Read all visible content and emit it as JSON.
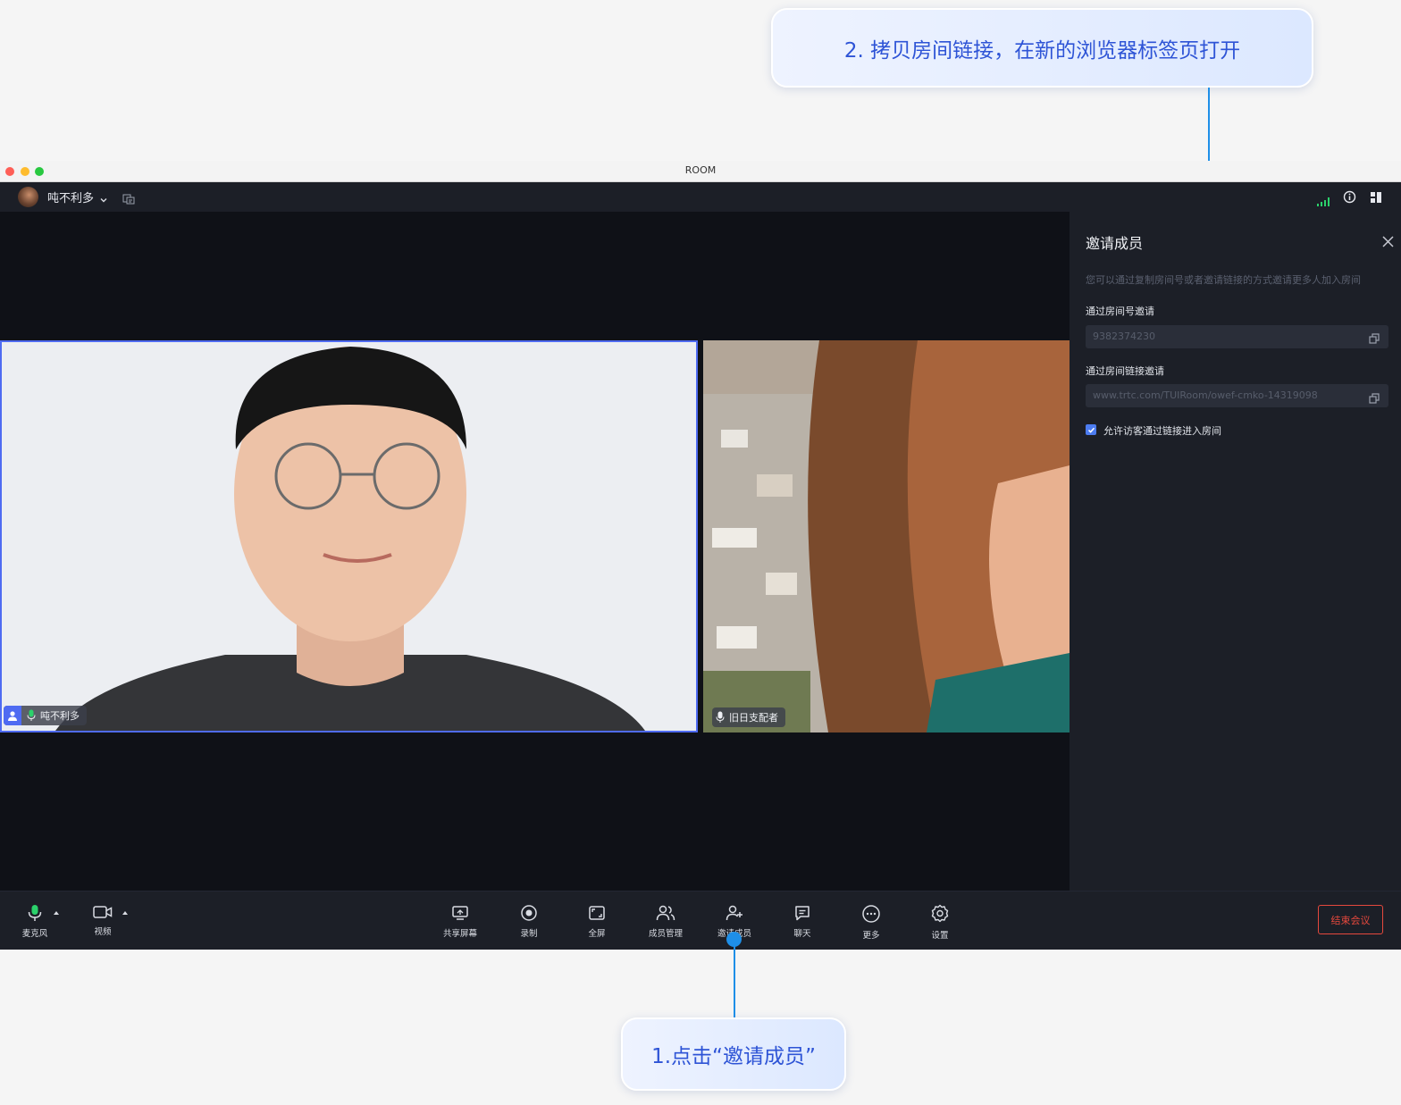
{
  "callouts": {
    "step2": "2. 拷贝房间链接，在新的浏览器标签页打开",
    "step1": "1.点击“邀请成员”"
  },
  "window": {
    "title": "ROOM"
  },
  "topbar": {
    "user_name": "吨不利多",
    "icons": [
      "avatar",
      "chevron-down-icon",
      "room-id-icon",
      "signal-icon",
      "info-icon",
      "layout-icon"
    ]
  },
  "stage": {
    "tiles": [
      {
        "name": "吨不利多",
        "mic": "active"
      },
      {
        "name": "旧日支配者",
        "mic": "on"
      }
    ]
  },
  "invite_panel": {
    "title": "邀请成员",
    "description": "您可以通过复制房间号或者邀请链接的方式邀请更多人加入房间",
    "room_id_label": "通过房间号邀请",
    "room_id_value": "9382374230",
    "link_label": "通过房间链接邀请",
    "link_value": "www.trtc.com/TUIRoom/owef-cmko-14319098",
    "allow_guest_label": "允许访客通过链接进入房间",
    "allow_guest_checked": true
  },
  "toolbar": {
    "left": [
      {
        "label": "麦克风",
        "icon": "microphone-icon"
      },
      {
        "label": "视频",
        "icon": "camera-icon"
      }
    ],
    "center": [
      {
        "label": "共享屏幕",
        "icon": "share-screen-icon"
      },
      {
        "label": "录制",
        "icon": "record-icon"
      },
      {
        "label": "全屏",
        "icon": "fullscreen-icon"
      },
      {
        "label": "成员管理",
        "icon": "members-icon"
      },
      {
        "label": "邀请成员",
        "icon": "invite-member-icon"
      },
      {
        "label": "聊天",
        "icon": "chat-icon"
      },
      {
        "label": "更多",
        "icon": "more-icon"
      },
      {
        "label": "设置",
        "icon": "settings-icon"
      }
    ],
    "end_label": "结束会议"
  },
  "colors": {
    "accent": "#4f6bf2",
    "callout_text": "#2e54d6",
    "connector": "#1e8fe8",
    "danger": "#e5483d",
    "mic_active": "#2bd16b"
  }
}
